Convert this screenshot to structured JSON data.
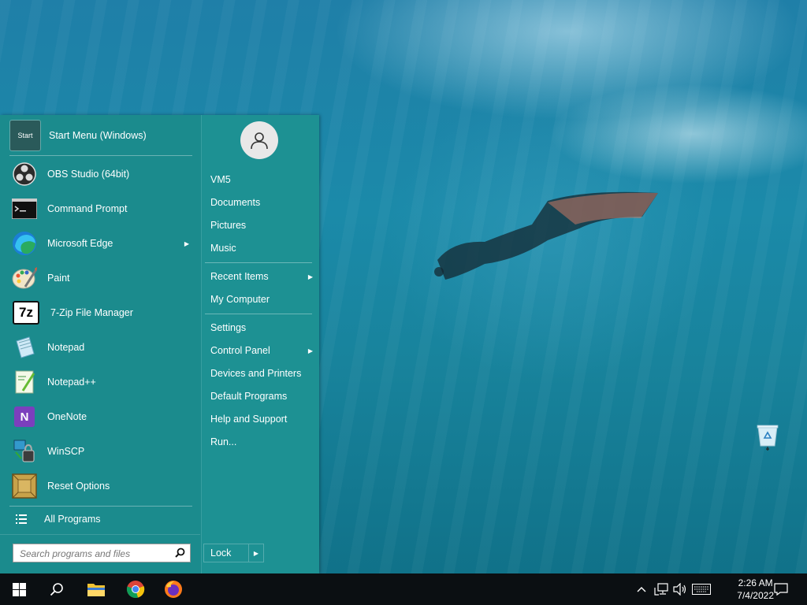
{
  "start_menu": {
    "programs": [
      {
        "label": "Start Menu (Windows)",
        "icon": "start-menu-icon"
      },
      {
        "label": "OBS Studio (64bit)",
        "icon": "obs-icon"
      },
      {
        "label": "Command Prompt",
        "icon": "cmd-icon"
      },
      {
        "label": "Microsoft Edge",
        "icon": "edge-icon",
        "submenu": true
      },
      {
        "label": "Paint",
        "icon": "paint-icon"
      },
      {
        "label": "7-Zip File Manager",
        "icon": "7zip-icon"
      },
      {
        "label": "Notepad",
        "icon": "notepad-icon"
      },
      {
        "label": "Notepad++",
        "icon": "notepadpp-icon"
      },
      {
        "label": "OneNote",
        "icon": "onenote-icon"
      },
      {
        "label": "WinSCP",
        "icon": "winscp-icon"
      },
      {
        "label": "Reset Options",
        "icon": "dosbox-icon"
      }
    ],
    "all_programs": "All Programs",
    "search_placeholder": "Search programs and files",
    "start_icon_text": "Start",
    "icon_text": {
      "seven_zip": "7z",
      "onenote": "N"
    },
    "user_links": [
      "VM5",
      "Documents",
      "Pictures",
      "Music"
    ],
    "recent_items": "Recent Items",
    "my_computer": "My Computer",
    "system_links": [
      "Settings",
      "Control Panel",
      "Devices and Printers",
      "Default Programs",
      "Help and Support",
      "Run..."
    ],
    "lock_label": "Lock"
  },
  "taskbar": {
    "time": "2:26 AM",
    "date": "7/4/2022",
    "pinned": [
      "windows-start-icon",
      "search-icon",
      "file-explorer-icon",
      "chrome-icon",
      "firefox-icon"
    ]
  },
  "desktop": {
    "icons": [
      "recycle-bin-icon"
    ]
  }
}
